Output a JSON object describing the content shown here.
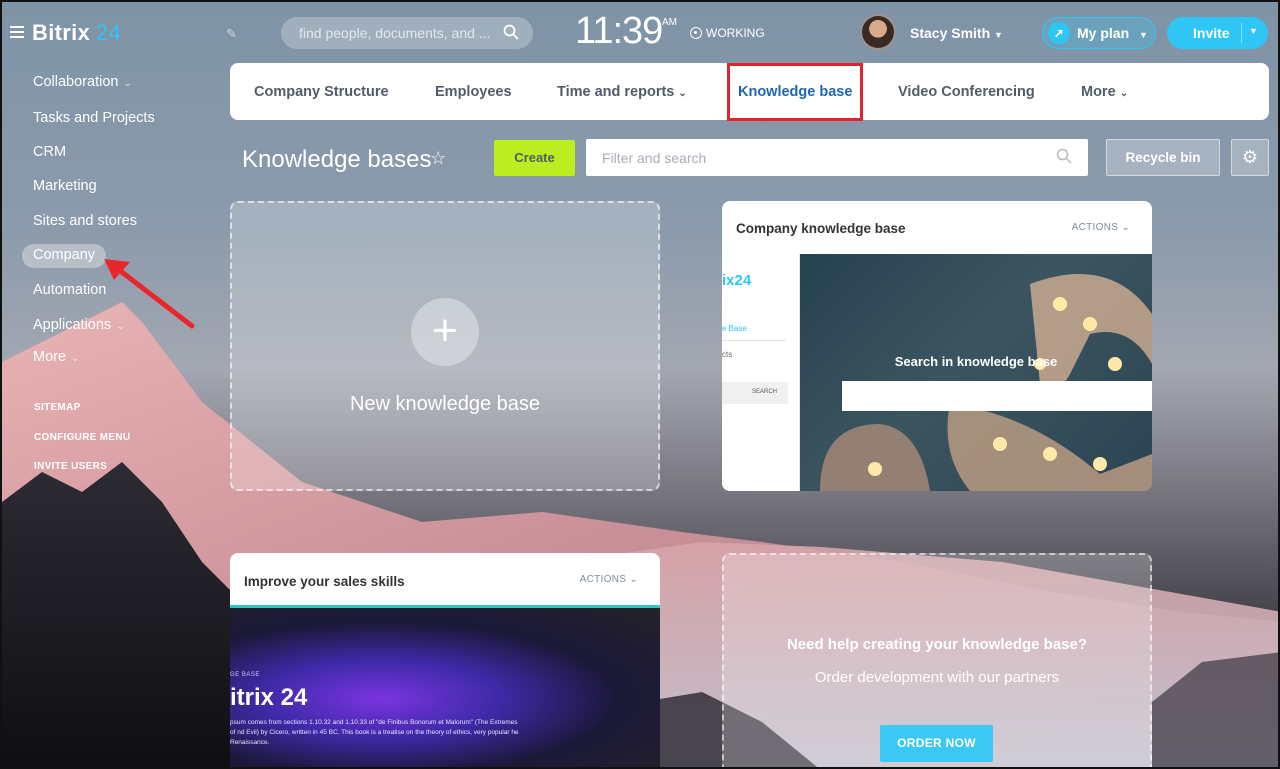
{
  "app": {
    "logo_text": "Bitrix",
    "logo_num": "24"
  },
  "topbar": {
    "search_placeholder": "find people, documents, and ...",
    "time": "11:39",
    "time_suffix": "AM",
    "work_status": "WORKING",
    "user_name": "Stacy Smith",
    "my_plan_label": "My plan",
    "invite_label": "Invite"
  },
  "sidebar": {
    "items": [
      {
        "label": "Collaboration"
      },
      {
        "label": "Tasks and Projects"
      },
      {
        "label": "CRM"
      },
      {
        "label": "Marketing"
      },
      {
        "label": "Sites and stores"
      },
      {
        "label": "Company"
      },
      {
        "label": "Automation"
      },
      {
        "label": "Applications"
      },
      {
        "label": "More"
      }
    ],
    "links": [
      {
        "label": "SITEMAP"
      },
      {
        "label": "CONFIGURE MENU"
      },
      {
        "label": "INVITE USERS"
      }
    ]
  },
  "tabs": [
    {
      "label": "Company Structure"
    },
    {
      "label": "Employees"
    },
    {
      "label": "Time and reports"
    },
    {
      "label": "Knowledge base"
    },
    {
      "label": "Video Conferencing"
    },
    {
      "label": "More"
    }
  ],
  "header": {
    "title": "Knowledge bases",
    "create_label": "Create",
    "filter_placeholder": "Filter and search",
    "recycle_label": "Recycle bin"
  },
  "cards": {
    "new_kb_label": "New knowledge base",
    "company_kb": {
      "title": "Company knowledge base",
      "actions": "ACTIONS",
      "preview_logo": "ix24",
      "preview_link": "e Base",
      "preview_item": "cts",
      "preview_button": "SEARCH",
      "hero_text": "Search in knowledge base"
    },
    "sales_kb": {
      "title": "Improve your sales skills",
      "actions": "ACTIONS",
      "preview_tag": "GE BASE",
      "preview_logo": "itrix 24",
      "preview_text": "psum comes from sections 1.10.32 and 1.10.33 of \"de Finibus Bonorum et Malorum\" (The Extremes of nd Evil) by Cicero, written in 45 BC. This book is a treatise on the theory of ethics, very popular he Renaissance."
    },
    "help": {
      "title": "Need help creating your knowledge base?",
      "subtitle": "Order development with our partners",
      "button": "ORDER NOW"
    }
  },
  "colors": {
    "accent": "#2fc6f6",
    "create_btn": "#bbed21",
    "highlight_box": "#e0242a",
    "active_tab": "#2067b0"
  }
}
